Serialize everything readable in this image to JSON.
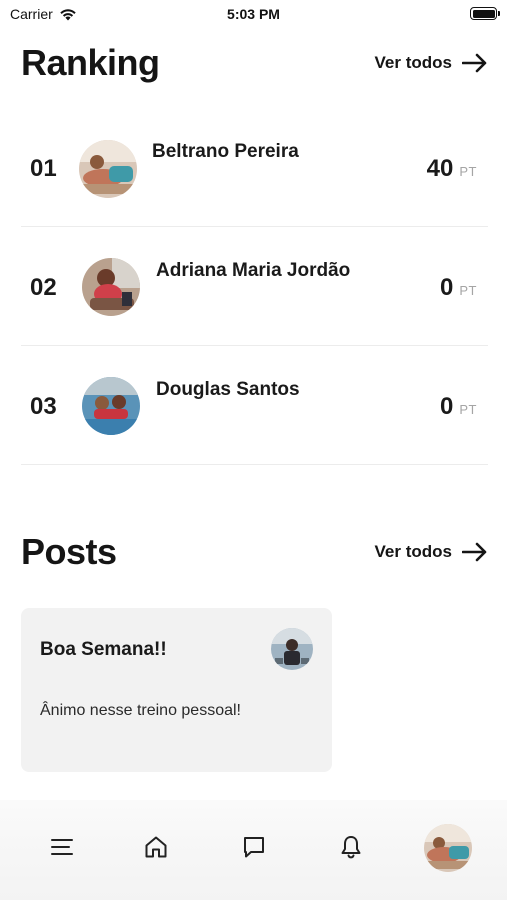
{
  "status_bar": {
    "carrier": "Carrier",
    "time": "5:03 PM"
  },
  "ranking": {
    "title": "Ranking",
    "see_all": "Ver todos",
    "items": [
      {
        "position": "01",
        "name": "Beltrano Pereira",
        "points": "40",
        "unit": "PT"
      },
      {
        "position": "02",
        "name": "Adriana Maria Jordão",
        "points": "0",
        "unit": "PT"
      },
      {
        "position": "03",
        "name": "Douglas Santos",
        "points": "0",
        "unit": "PT"
      }
    ]
  },
  "posts": {
    "title": "Posts",
    "see_all": "Ver todos",
    "items": [
      {
        "title": "Boa Semana!!",
        "body": "Ânimo nesse treino pessoal!"
      }
    ]
  },
  "bottom_nav": {
    "items": [
      "menu-icon",
      "home-icon",
      "chat-icon",
      "bell-icon",
      "profile-avatar"
    ]
  }
}
